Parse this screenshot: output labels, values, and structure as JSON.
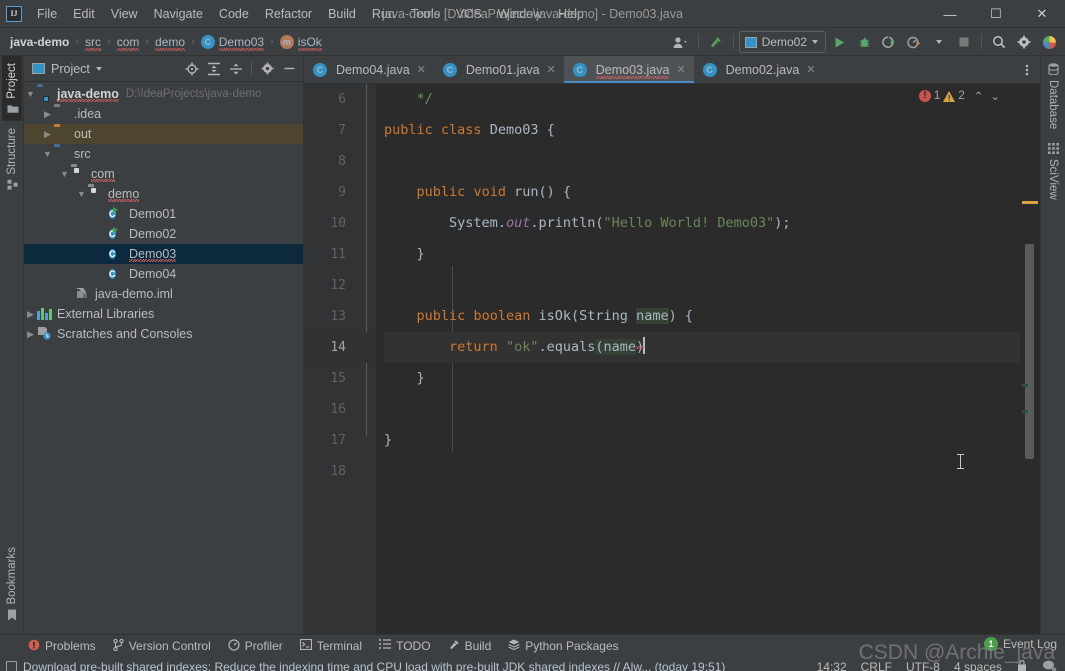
{
  "window": {
    "title": "java-demo [D:\\IdeaProjects\\java-demo] - Demo03.java",
    "minimize": "—",
    "maximize": "☐",
    "close": "✕",
    "logo": "IJ"
  },
  "menu": {
    "items": [
      "File",
      "Edit",
      "View",
      "Navigate",
      "Code",
      "Refactor",
      "Build",
      "Run",
      "Tools",
      "VCS",
      "Window",
      "Help"
    ]
  },
  "breadcrumb": {
    "items": [
      {
        "label": "java-demo",
        "icon": "",
        "bold": true,
        "squiggly": false
      },
      {
        "label": "src",
        "icon": "",
        "bold": false,
        "squiggly": true
      },
      {
        "label": "com",
        "icon": "",
        "bold": false,
        "squiggly": true
      },
      {
        "label": "demo",
        "icon": "",
        "bold": false,
        "squiggly": true
      },
      {
        "label": "Demo03",
        "icon": "class-icon",
        "bold": false,
        "squiggly": true
      },
      {
        "label": "isOk",
        "icon": "method-icon",
        "bold": false,
        "squiggly": true
      }
    ],
    "separator": "›"
  },
  "toolbar": {
    "account_icon": "user-account-icon",
    "build_icon": "build-hammer-icon",
    "run_config": "Demo02",
    "run_icon": "run-icon",
    "debug_icon": "debug-bug-icon",
    "run_coverage_icon": "run-with-coverage-icon",
    "profiler_icon": "profiler-icon",
    "stop_icon": "stop-icon",
    "search_icon": "search-icon",
    "settings_icon": "gear-icon",
    "updates_icon": "ide-updates-icon"
  },
  "left_strip": {
    "tabs": [
      {
        "label": "Project",
        "icon": "project-folder-icon",
        "active": true
      },
      {
        "label": "Structure",
        "icon": "structure-icon",
        "active": false
      }
    ],
    "bottom_tabs": [
      {
        "label": "Bookmarks",
        "icon": "bookmark-icon",
        "active": false
      }
    ]
  },
  "right_strip": {
    "tabs": [
      {
        "label": "Database",
        "icon": "database-icon"
      },
      {
        "label": "SciView",
        "icon": "sciview-grid-icon"
      }
    ]
  },
  "project_panel": {
    "title": "Project",
    "dropdown_icon": "chevron-down-icon",
    "actions": [
      "locate-target-icon",
      "expand-all-icon",
      "collapse-all-icon",
      "gear-icon",
      "hide-icon"
    ],
    "tree": [
      {
        "depth": 0,
        "label": "java-demo",
        "path": "D:\\IdeaProjects\\java-demo",
        "icon": "module-folder-icon",
        "arrow": "expanded",
        "bold": true,
        "squiggly": true,
        "state": "normal"
      },
      {
        "depth": 1,
        "label": ".idea",
        "path": "",
        "icon": "folder-grey-icon",
        "arrow": "collapsed",
        "bold": false,
        "squiggly": false,
        "state": "normal"
      },
      {
        "depth": 1,
        "label": "out",
        "path": "",
        "icon": "folder-orange-icon",
        "arrow": "collapsed",
        "bold": false,
        "squiggly": false,
        "state": "highlight"
      },
      {
        "depth": 1,
        "label": "src",
        "path": "",
        "icon": "source-folder-icon",
        "arrow": "expanded",
        "bold": false,
        "squiggly": false,
        "state": "normal"
      },
      {
        "depth": 2,
        "label": "com",
        "path": "",
        "icon": "package-icon",
        "arrow": "expanded",
        "bold": false,
        "squiggly": true,
        "state": "normal"
      },
      {
        "depth": 3,
        "label": "demo",
        "path": "",
        "icon": "package-icon",
        "arrow": "expanded",
        "bold": false,
        "squiggly": true,
        "state": "normal"
      },
      {
        "depth": 4,
        "label": "Demo01",
        "path": "",
        "icon": "java-class-runnable-icon",
        "arrow": "none",
        "bold": false,
        "squiggly": false,
        "state": "normal"
      },
      {
        "depth": 4,
        "label": "Demo02",
        "path": "",
        "icon": "java-class-runnable-icon",
        "arrow": "none",
        "bold": false,
        "squiggly": false,
        "state": "normal"
      },
      {
        "depth": 4,
        "label": "Demo03",
        "path": "",
        "icon": "java-class-icon",
        "arrow": "none",
        "bold": false,
        "squiggly": true,
        "state": "selected"
      },
      {
        "depth": 4,
        "label": "Demo04",
        "path": "",
        "icon": "java-class-icon",
        "arrow": "none",
        "bold": false,
        "squiggly": false,
        "state": "normal"
      },
      {
        "depth": 2,
        "label": "java-demo.iml",
        "path": "",
        "icon": "iml-file-icon",
        "arrow": "none",
        "bold": false,
        "squiggly": false,
        "state": "normal"
      },
      {
        "depth": 0,
        "label": "External Libraries",
        "path": "",
        "icon": "libraries-icon",
        "arrow": "collapsed",
        "bold": false,
        "squiggly": false,
        "state": "normal"
      },
      {
        "depth": 0,
        "label": "Scratches and Consoles",
        "path": "",
        "icon": "scratches-icon",
        "arrow": "collapsed",
        "bold": false,
        "squiggly": false,
        "state": "normal"
      }
    ]
  },
  "editor": {
    "tabs": [
      {
        "label": "Demo04.java",
        "active": false,
        "squiggly": false,
        "close": "✕",
        "icon": "java-class-icon"
      },
      {
        "label": "Demo01.java",
        "active": false,
        "squiggly": false,
        "close": "✕",
        "icon": "java-class-runnable-icon"
      },
      {
        "label": "Demo03.java",
        "active": true,
        "squiggly": true,
        "close": "✕",
        "icon": "java-class-icon"
      },
      {
        "label": "Demo02.java",
        "active": false,
        "squiggly": false,
        "close": "✕",
        "icon": "java-class-runnable-icon"
      }
    ],
    "tab_overflow_icon": "more-options-icon",
    "inspections": {
      "error_count": "1",
      "warning_count": "2",
      "error_icon": "error-icon",
      "warning_icon": "warning-icon",
      "prev_icon": "⌃",
      "next_icon": "⌄"
    },
    "line_numbers": [
      "6",
      "7",
      "8",
      "9",
      "10",
      "11",
      "12",
      "13",
      "14",
      "15",
      "16",
      "17",
      "18"
    ],
    "current_line": "14",
    "lines": [
      {
        "n": "6",
        "text": "    */"
      },
      {
        "n": "7",
        "text": "public class Demo03 {"
      },
      {
        "n": "8",
        "text": ""
      },
      {
        "n": "9",
        "text": "    public void run() {"
      },
      {
        "n": "10",
        "text": "        System.out.println(\"Hello World! Demo03\");"
      },
      {
        "n": "11",
        "text": "    }"
      },
      {
        "n": "12",
        "text": ""
      },
      {
        "n": "13",
        "text": "    public boolean isOk(String name) {"
      },
      {
        "n": "14",
        "text": "        return \"ok\".equals(name)"
      },
      {
        "n": "15",
        "text": "    }"
      },
      {
        "n": "16",
        "text": ""
      },
      {
        "n": "17",
        "text": "}"
      },
      {
        "n": "18",
        "text": ""
      }
    ]
  },
  "bottom_tools": [
    {
      "label": "Problems",
      "icon": "problems-icon"
    },
    {
      "label": "Version Control",
      "icon": "version-control-icon"
    },
    {
      "label": "Profiler",
      "icon": "profiler-icon"
    },
    {
      "label": "Terminal",
      "icon": "terminal-icon"
    },
    {
      "label": "TODO",
      "icon": "todo-list-icon"
    },
    {
      "label": "Build",
      "icon": "build-hammer-icon"
    },
    {
      "label": "Python Packages",
      "icon": "python-packages-icon"
    }
  ],
  "status_bar": {
    "message": "Download pre-built shared indexes: Reduce the indexing time and CPU load with pre-built JDK shared indexes // Alw... (today 19:51)",
    "message_icon": "notification-icon",
    "caret_position": "14:32",
    "line_separator": "CRLF",
    "encoding": "UTF-8",
    "indent": "4 spaces",
    "lock_icon": "read-only-lock-icon",
    "inspections_icon": "inspection-level-icon",
    "event_log": "Event Log",
    "event_log_count": "1"
  },
  "watermark": "CSDN @Archie_java",
  "colors": {
    "accent_blue": "#4a88c7",
    "error_red": "#c75450",
    "warning_orange": "#d9a343",
    "keyword_orange": "#cc7832",
    "string_green": "#6a8759",
    "comment_green": "#629755",
    "editor_bg": "#2b2b2b",
    "panel_bg": "#3c3f41",
    "selection_blue": "#0d293e"
  }
}
